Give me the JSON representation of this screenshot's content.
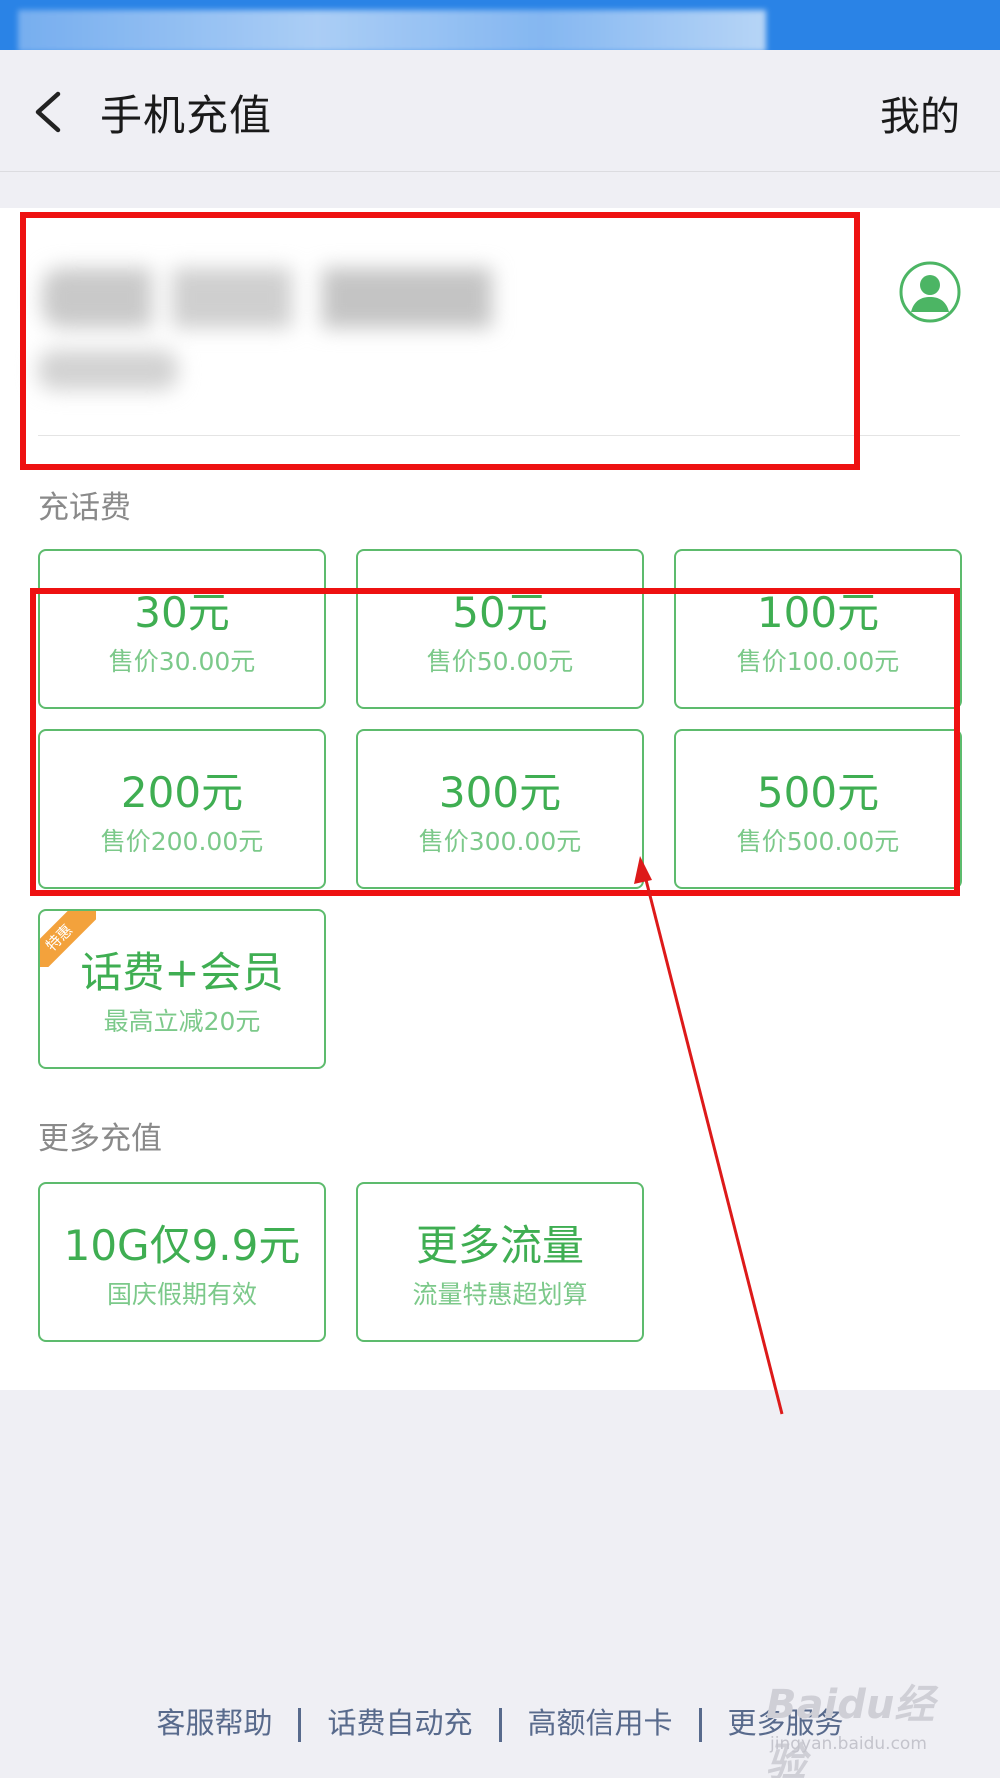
{
  "nav": {
    "title": "手机充值",
    "right_label": "我的"
  },
  "sections": {
    "topup_title": "充话费",
    "more_title": "更多充值"
  },
  "topup_options": [
    {
      "amount": "30元",
      "price": "售价30.00元"
    },
    {
      "amount": "50元",
      "price": "售价50.00元"
    },
    {
      "amount": "100元",
      "price": "售价100.00元"
    },
    {
      "amount": "200元",
      "price": "售价200.00元"
    },
    {
      "amount": "300元",
      "price": "售价300.00元"
    },
    {
      "amount": "500元",
      "price": "售价500.00元"
    }
  ],
  "promo": {
    "badge": "特惠",
    "title": "话费+会员",
    "subtitle": "最高立减20元"
  },
  "more_options": [
    {
      "title": "10G仅9.9元",
      "subtitle": "国庆假期有效"
    },
    {
      "title": "更多流量",
      "subtitle": "流量特惠超划算"
    }
  ],
  "footer": [
    "客服帮助",
    "话费自动充",
    "高额信用卡",
    "更多服务"
  ],
  "watermark": {
    "logo": "Baidu经验",
    "url": "jingyan.baidu.com"
  },
  "icons": {
    "back": "chevron-left-icon",
    "avatar": "user-avatar-icon"
  },
  "colors": {
    "accent_green": "#3fae52",
    "border_green": "#5dbb6d",
    "status_bar_blue": "#2a83e6",
    "annotation_red": "#ee1111",
    "badge_orange": "#f3a23c"
  }
}
